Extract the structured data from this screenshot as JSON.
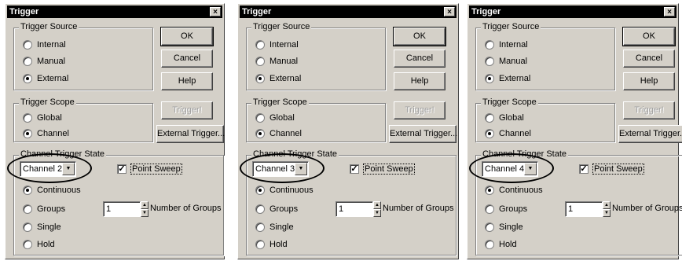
{
  "dialogs": [
    {
      "title": "Trigger",
      "close_glyph": "×",
      "trigger_source": {
        "label": "Trigger Source",
        "options": [
          "Internal",
          "Manual",
          "External"
        ],
        "selected": 2
      },
      "buttons": {
        "ok": "OK",
        "cancel": "Cancel",
        "help": "Help",
        "trigger": "Trigger!",
        "external_trigger": "External Trigger..."
      },
      "trigger_scope": {
        "label": "Trigger Scope",
        "options": [
          "Global",
          "Channel"
        ],
        "selected": 1
      },
      "channel_trigger_state": {
        "label": "Channel Trigger State",
        "channel": "Channel 2",
        "point_sweep_label": "Point Sweep",
        "point_sweep_checked": true,
        "modes": [
          "Continuous",
          "Groups",
          "Single",
          "Hold"
        ],
        "selected_mode": 0,
        "groups_value": "1",
        "number_of_groups_label": "Number of Groups"
      }
    },
    {
      "title": "Trigger",
      "close_glyph": "×",
      "trigger_source": {
        "label": "Trigger Source",
        "options": [
          "Internal",
          "Manual",
          "External"
        ],
        "selected": 2
      },
      "buttons": {
        "ok": "OK",
        "cancel": "Cancel",
        "help": "Help",
        "trigger": "Trigger!",
        "external_trigger": "External Trigger..."
      },
      "trigger_scope": {
        "label": "Trigger Scope",
        "options": [
          "Global",
          "Channel"
        ],
        "selected": 1
      },
      "channel_trigger_state": {
        "label": "Channel Trigger State",
        "channel": "Channel 3",
        "point_sweep_label": "Point Sweep",
        "point_sweep_checked": true,
        "modes": [
          "Continuous",
          "Groups",
          "Single",
          "Hold"
        ],
        "selected_mode": 0,
        "groups_value": "1",
        "number_of_groups_label": "Number of Groups"
      }
    },
    {
      "title": "Trigger",
      "close_glyph": "×",
      "trigger_source": {
        "label": "Trigger Source",
        "options": [
          "Internal",
          "Manual",
          "External"
        ],
        "selected": 2
      },
      "buttons": {
        "ok": "OK",
        "cancel": "Cancel",
        "help": "Help",
        "trigger": "Trigger!",
        "external_trigger": "External Trigger..."
      },
      "trigger_scope": {
        "label": "Trigger Scope",
        "options": [
          "Global",
          "Channel"
        ],
        "selected": 1
      },
      "channel_trigger_state": {
        "label": "Channel Trigger State",
        "channel": "Channel 4",
        "point_sweep_label": "Point Sweep",
        "point_sweep_checked": true,
        "modes": [
          "Continuous",
          "Groups",
          "Single",
          "Hold"
        ],
        "selected_mode": 0,
        "groups_value": "1",
        "number_of_groups_label": "Number of Groups"
      }
    }
  ]
}
